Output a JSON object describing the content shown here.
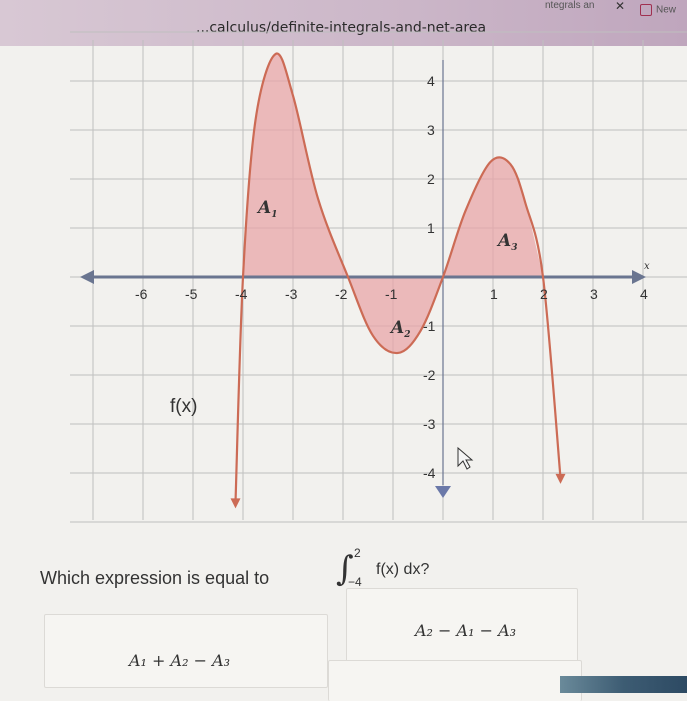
{
  "browser": {
    "url_text": "...calculus/definite-integrals-and-net-area",
    "tab_title": "ntegrals an",
    "tab_close": "✕",
    "new_tab_label": "New"
  },
  "graph": {
    "x_ticks": [
      "-6",
      "-5",
      "-4",
      "-3",
      "-2",
      "-1",
      "1",
      "2",
      "3",
      "4"
    ],
    "y_ticks": [
      "4",
      "3",
      "2",
      "1",
      "-1",
      "-2",
      "-3",
      "-4"
    ],
    "x_axis_label": "x",
    "function_label": "f(x)",
    "regions": [
      {
        "name": "A",
        "sub": "1"
      },
      {
        "name": "A",
        "sub": "2"
      },
      {
        "name": "A",
        "sub": "3"
      }
    ],
    "colors": {
      "curve": "#cc6b55",
      "fill": "#e8a6a8",
      "axis": "#6a7590",
      "grid": "#bfbfbf"
    }
  },
  "question": {
    "text": "Which expression is equal to",
    "upper": "2",
    "lower": "−4",
    "integrand": "f(x) dx?"
  },
  "options": [
    {
      "text": "A₁ + A₂ − A₃"
    },
    {
      "text": "A₂ − A₁ − A₃"
    }
  ]
}
